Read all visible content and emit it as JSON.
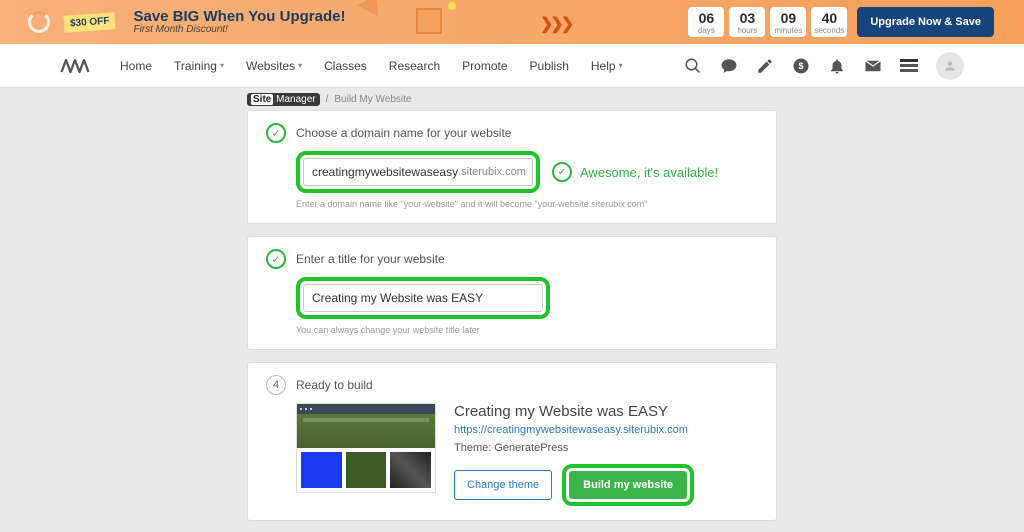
{
  "promo": {
    "badge": "$30 OFF",
    "headline": "Save BIG When You Upgrade!",
    "sub": "First Month Discount!",
    "countdown": [
      {
        "num": "06",
        "lbl": "days"
      },
      {
        "num": "03",
        "lbl": "hours"
      },
      {
        "num": "09",
        "lbl": "minutes"
      },
      {
        "num": "40",
        "lbl": "seconds"
      }
    ],
    "cta": "Upgrade Now & Save"
  },
  "nav": {
    "items": [
      "Home",
      "Training",
      "Websites",
      "Classes",
      "Research",
      "Promote",
      "Publish",
      "Help"
    ],
    "caret_indices": [
      1,
      2,
      7
    ]
  },
  "crumbs": {
    "site": "Site",
    "manager": "Manager",
    "sep": "/",
    "current": "Build My Website"
  },
  "step_domain": {
    "title": "Choose a domain name for your website",
    "value": "creatingmywebsitewaseasy",
    "suffix": ".siterubix.com",
    "avail": "Awesome, it's available!",
    "hint": "Enter a domain name like \"your-website\" and it will become \"your-website.siterubix.com\""
  },
  "step_title": {
    "title": "Enter a title for your website",
    "value": "Creating my Website was EASY",
    "hint": "You can always change your website title later"
  },
  "step_ready": {
    "num": "4",
    "title": "Ready to build",
    "site_title": "Creating my Website was EASY",
    "url": "https://creatingmywebsitewaseasy.siterubix.com",
    "theme_label": "Theme: GeneratePress",
    "thumb_label": "GeneratePress",
    "change_btn": "Change theme",
    "build_btn": "Build my website"
  }
}
